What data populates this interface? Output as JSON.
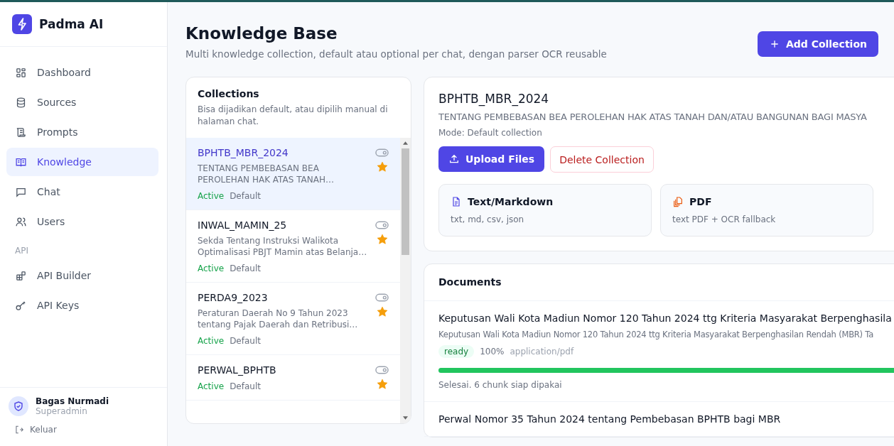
{
  "brand": {
    "name": "Padma AI"
  },
  "nav": [
    {
      "label": "Dashboard",
      "kind": "grid",
      "selected": false
    },
    {
      "label": "Sources",
      "kind": "database",
      "selected": false
    },
    {
      "label": "Prompts",
      "kind": "scroll",
      "selected": false
    },
    {
      "label": "Knowledge",
      "kind": "book",
      "selected": true
    },
    {
      "label": "Chat",
      "kind": "chat",
      "selected": false
    },
    {
      "label": "Users",
      "kind": "users",
      "selected": false
    }
  ],
  "nav_section": {
    "title": "API",
    "items": [
      {
        "label": "API Builder",
        "kind": "blocks",
        "selected": false
      },
      {
        "label": "API Keys",
        "kind": "key",
        "selected": false
      }
    ]
  },
  "user": {
    "name": "Bagas Nurmadi",
    "role": "Superadmin",
    "logout": "Keluar"
  },
  "header": {
    "title": "Knowledge Base",
    "subtitle": "Multi knowledge collection, default atau optional per chat, dengan parser OCR reusable",
    "action": "Add Collection"
  },
  "collections": {
    "title": "Collections",
    "subtitle": "Bisa dijadikan default, atau dipilih manual di halaman chat.",
    "items": [
      {
        "name": "BPHTB_MBR_2024",
        "description": "TENTANG PEMBEBASAN BEA PEROLEHAN HAK ATAS TANAH…",
        "status": "Active",
        "mode": "Default",
        "default": true,
        "selected": true
      },
      {
        "name": "INWAL_MAMIN_25",
        "description": "Sekda Tentang Instruksi Walikota Optimalisasi PBJT Mamin atas Belanja…",
        "status": "Active",
        "mode": "Default",
        "default": true,
        "selected": false
      },
      {
        "name": "PERDA9_2023",
        "description": "Peraturan Daerah No 9 Tahun 2023 tentang Pajak Daerah dan Retribusi…",
        "status": "Active",
        "mode": "Default",
        "default": true,
        "selected": false
      },
      {
        "name": "PERWAL_BPHTB",
        "status": "Active",
        "mode": "Default",
        "default": true,
        "selected": false
      }
    ]
  },
  "detail": {
    "title": "BPHTB_MBR_2024",
    "description": "TENTANG PEMBEBASAN BEA PEROLEHAN HAK ATAS TANAH DAN/ATAU BANGUNAN BAGI MASYA",
    "mode": "Mode: Default collection",
    "upload": "Upload Files",
    "delete": "Delete Collection",
    "parsers": [
      {
        "kind": "text",
        "title": "Text/Markdown",
        "formats": "txt, md, csv, json"
      },
      {
        "kind": "pdf",
        "title": "PDF",
        "formats": "text PDF + OCR fallback"
      }
    ]
  },
  "documents": {
    "title": "Documents",
    "items": [
      {
        "title": "Keputusan Wali Kota Madiun Nomor 120 Tahun 2024 ttg Kriteria Masyarakat Berpenghasila",
        "description": "Keputusan Wali Kota Madiun Nomor 120 Tahun 2024 ttg Kriteria Masyarakat Berpenghasilan Rendah (MBR) Ta",
        "status": "ready",
        "percent": "100%",
        "type": "application/pdf",
        "level": 1,
        "message": "Selesai. 6 chunk siap dipakai"
      },
      {
        "title": "Perwal Nomor 35 Tahun 2024 tentang Pembebasan BPHTB bagi MBR"
      }
    ]
  }
}
